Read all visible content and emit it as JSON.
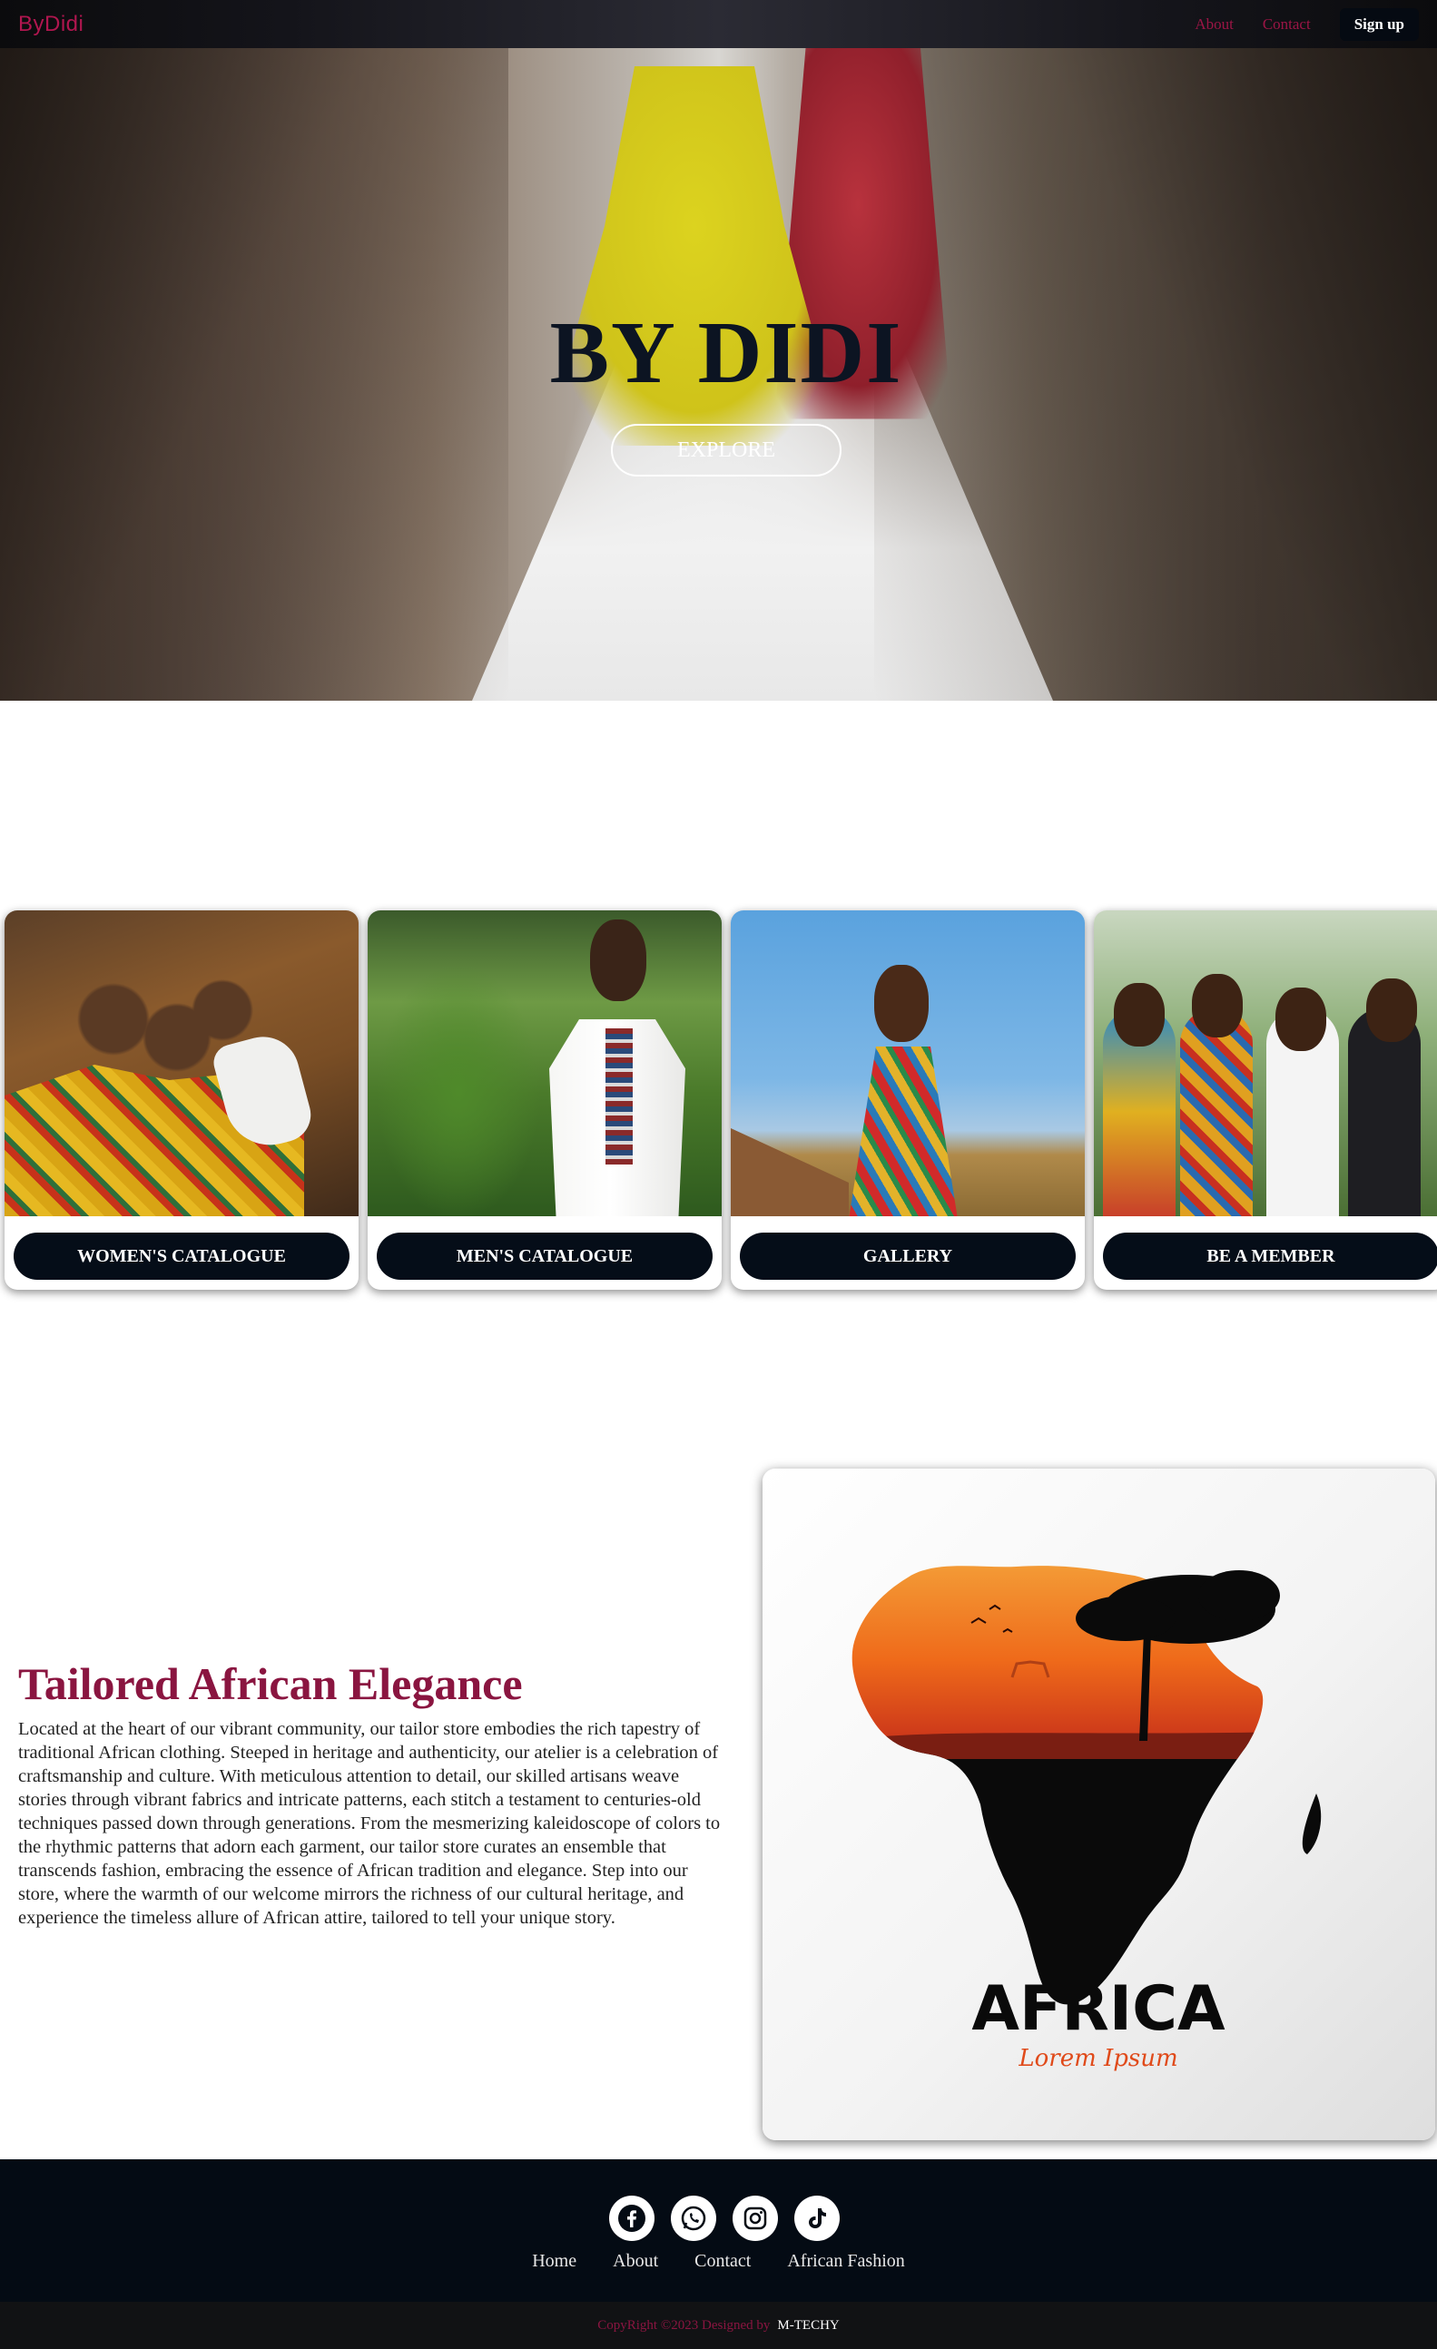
{
  "navbar": {
    "brand": "ByDidi",
    "links": [
      "About",
      "Contact"
    ],
    "signup_label": "Sign up"
  },
  "hero": {
    "title": "BY DIDI",
    "explore_label": "EXPLORE"
  },
  "cards": [
    {
      "label": "WOMEN'S CATALOGUE"
    },
    {
      "label": "MEN'S CATALOGUE"
    },
    {
      "label": "GALLERY"
    },
    {
      "label": "BE A MEMBER"
    }
  ],
  "about": {
    "title": "Tailored African Elegance",
    "text": "Located at the heart of our vibrant community, our tailor store embodies the rich tapestry of traditional African clothing. Steeped in heritage and authenticity, our atelier is a celebration of craftsmanship and culture. With meticulous attention to detail, our skilled artisans weave stories through vibrant fabrics and intricate patterns, each stitch a testament to centuries-old techniques passed down through generations. From the mesmerizing kaleidoscope of colors to the rhythmic patterns that adorn each garment, our tailor store curates an ensemble that transcends fashion, embracing the essence of African tradition and elegance. Step into our store, where the warmth of our welcome mirrors the richness of our cultural heritage, and experience the timeless allure of African attire, tailored to tell your unique story.",
    "image_heading": "AFRICA",
    "image_sub": "Lorem Ipsum"
  },
  "footer": {
    "social_icons": [
      "facebook-icon",
      "whatsapp-icon",
      "instagram-icon",
      "tiktok-icon"
    ],
    "links": [
      "Home",
      "About",
      "Contact",
      "African Fashion"
    ],
    "copyright": "CopyRight ©2023 Designed by",
    "author": "M-TECHY"
  },
  "colors": {
    "brand": "#b0164f",
    "accent": "#8a1540",
    "dark": "#050d18"
  }
}
